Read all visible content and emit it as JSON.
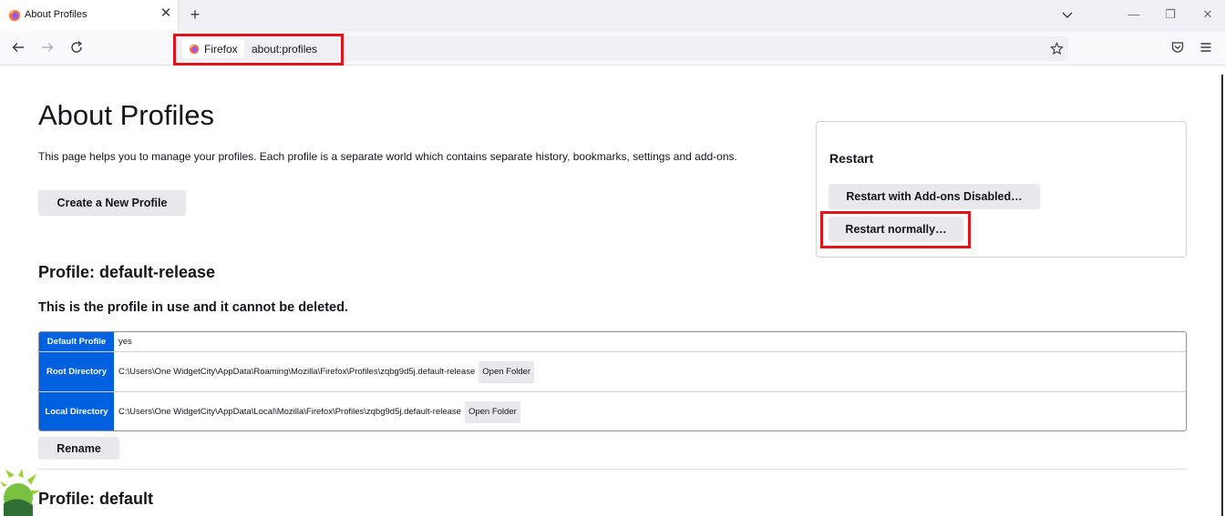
{
  "tab": {
    "title": "About Profiles",
    "close": "✕"
  },
  "newtab": "+",
  "window": {
    "minimize": "—",
    "restore": "❐",
    "close": "✕"
  },
  "urlbar": {
    "identity_label": "Firefox",
    "url": "about:profiles"
  },
  "page": {
    "title": "About Profiles",
    "intro": "This page helps you to manage your profiles. Each profile is a separate world which contains separate history, bookmarks, settings and add-ons.",
    "create_button": "Create a New Profile"
  },
  "restart": {
    "title": "Restart",
    "addons_disabled_button": "Restart with Add-ons Disabled…",
    "normally_button": "Restart normally…"
  },
  "profile1": {
    "heading": "Profile: default-release",
    "inuse_note": "This is the profile in use and it cannot be deleted.",
    "rows": [
      {
        "label": "Default Profile",
        "value": "yes"
      },
      {
        "label": "Root Directory",
        "value": "C:\\Users\\One WidgetCity\\AppData\\Roaming\\Mozilla\\Firefox\\Profiles\\zqbg9d5j.default-release",
        "button": "Open Folder"
      },
      {
        "label": "Local Directory",
        "value": "C:\\Users\\One WidgetCity\\AppData\\Local\\Mozilla\\Firefox\\Profiles\\zqbg9d5j.default-release",
        "button": "Open Folder"
      }
    ],
    "rename_button": "Rename"
  },
  "profile2": {
    "heading": "Profile: default"
  },
  "colors": {
    "accent": "#0061e0",
    "highlight": "#e0131a",
    "button_bg": "#e9e9ed"
  },
  "icons": [
    "firefox-icon",
    "close-icon",
    "plus-icon",
    "chevron-down-icon",
    "back-arrow-icon",
    "forward-arrow-icon",
    "reload-icon",
    "star-icon",
    "pocket-icon",
    "menu-icon"
  ]
}
